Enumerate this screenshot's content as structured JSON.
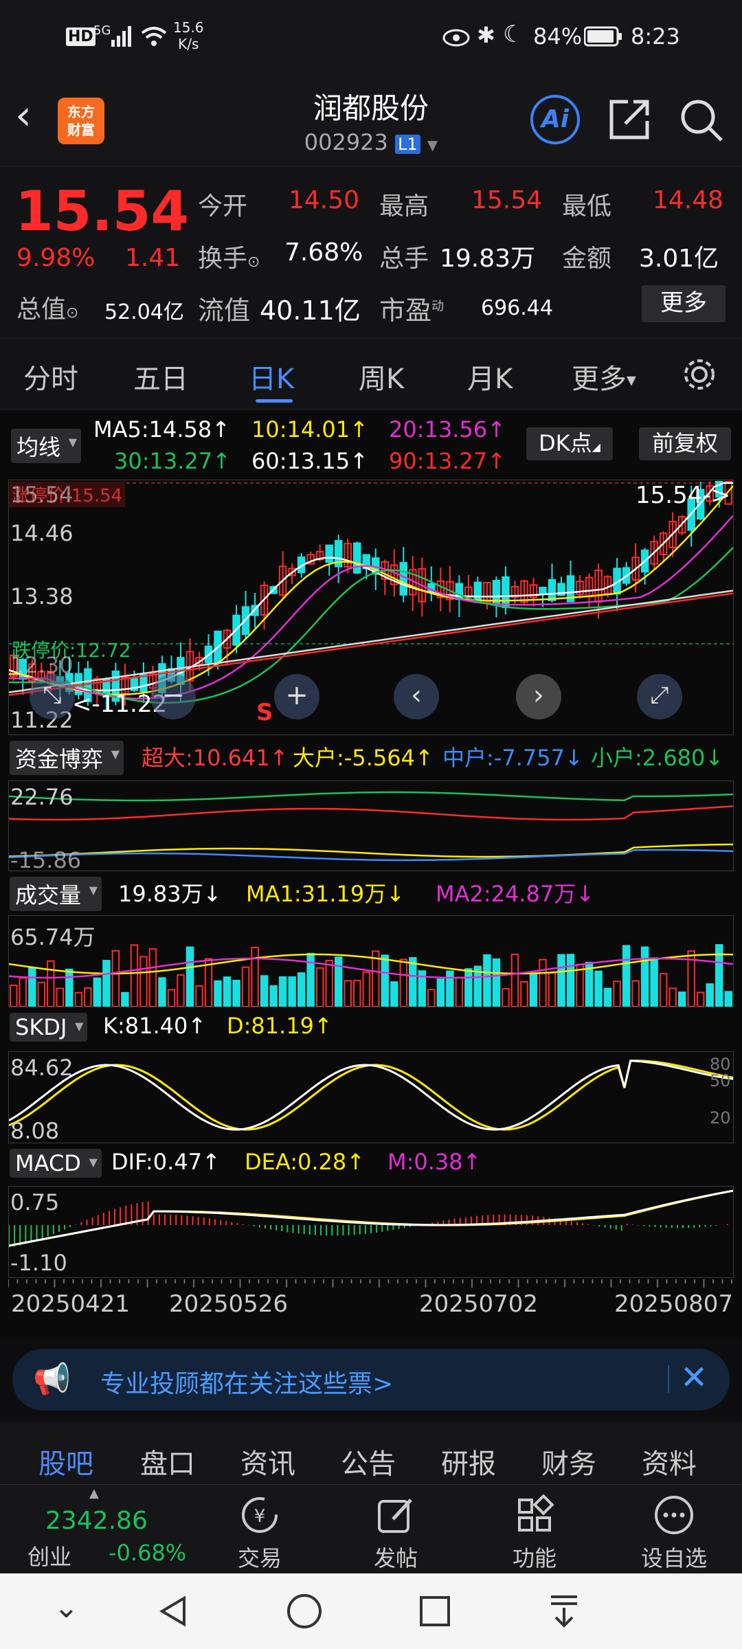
{
  "status_bar": {
    "net": "HD",
    "signal": "5G",
    "speed_top": "15.6",
    "speed_bot": "K/s",
    "battery": "84%",
    "time": "8:23"
  },
  "header": {
    "title": "润都股份",
    "code": "002923",
    "level": "L1",
    "logo_top": "东方",
    "logo_bot": "财富",
    "ai_label": "Ai"
  },
  "quote": {
    "price": "15.54",
    "change_pct": "9.98%",
    "change": "1.41",
    "open_label": "今开",
    "open": "14.50",
    "high_label": "最高",
    "high": "15.54",
    "low_label": "最低",
    "low": "14.48",
    "turnover_label": "换手",
    "turnover": "7.68%",
    "volume_label": "总手",
    "volume": "19.83万",
    "amount_label": "金额",
    "amount": "3.01亿",
    "mcap_label": "总值",
    "mcap": "52.04亿",
    "float_label": "流值",
    "float": "40.11亿",
    "pe_label": "市盈",
    "pe_sup": "动",
    "pe": "696.44",
    "more": "更多"
  },
  "tabs": [
    "分时",
    "五日",
    "日K",
    "周K",
    "月K",
    "更多"
  ],
  "active_tab": "日K",
  "ma": {
    "selector": "均线",
    "ma5": "MA5:14.58",
    "ma10": "10:14.01",
    "ma20": "20:13.56",
    "ma30": "30:13.27",
    "ma60": "60:13.15",
    "ma90": "90:13.27",
    "dk": "DK点",
    "fq": "前复权"
  },
  "main_chart": {
    "y_top": "15.54",
    "y_mid1": "14.46",
    "y_mid2": "13.38",
    "y_mid3": "12.30",
    "y_low": "11.22",
    "limit_up": "涨停价:15.54",
    "limit_down": "跌停价:12.72",
    "last_price_arrow": "15.54->",
    "low_marker": "<-11.22",
    "sell_mark": "S"
  },
  "capital": {
    "selector": "资金博弈",
    "super": "超大:10.641",
    "large": "大户:-5.564",
    "mid": "中户:-7.757",
    "small": "小户:2.680",
    "y_top": "22.76",
    "y_bot": "-15.86"
  },
  "volume": {
    "selector": "成交量",
    "vol": "19.83万",
    "ma1": "MA1:31.19万",
    "ma2": "MA2:24.87万",
    "y_top": "65.74万"
  },
  "skdj": {
    "selector": "SKDJ",
    "k": "K:81.40",
    "d": "D:81.19",
    "y_top": "84.62",
    "y_bot": "8.08",
    "r80": "80",
    "r50": "50",
    "r20": "20"
  },
  "macd": {
    "selector": "MACD",
    "dif": "DIF:0.47",
    "dea": "DEA:0.28",
    "m": "M:0.38",
    "y_top": "0.75",
    "y_bot": "-1.10"
  },
  "dates": [
    "20250421",
    "20250526",
    "20250702",
    "20250807"
  ],
  "banner": {
    "text": "专业投顾都在关注这些票>"
  },
  "subtabs": [
    "股吧",
    "盘口",
    "资讯",
    "公告",
    "研报",
    "财务",
    "资料"
  ],
  "index": {
    "value": "2342.86",
    "name": "创业",
    "change": "-0.68%"
  },
  "bottom_actions": [
    "交易",
    "发帖",
    "功能",
    "设自选"
  ]
}
